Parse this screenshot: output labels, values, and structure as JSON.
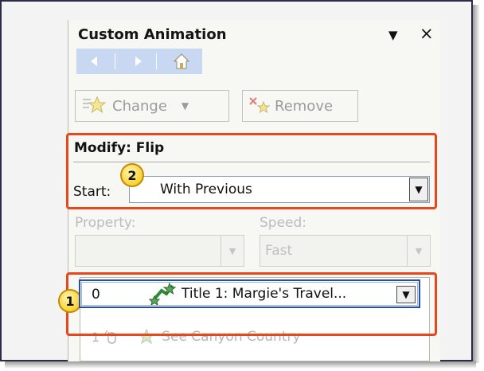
{
  "pane": {
    "title": "Custom Animation",
    "menu_icon": "triangle-down",
    "close_icon": "close-x"
  },
  "nav": {
    "back_icon": "arrow-left",
    "forward_icon": "arrow-right",
    "home_icon": "home"
  },
  "toolbar": {
    "change_label": "Change",
    "remove_label": "Remove"
  },
  "modify": {
    "heading": "Modify: Flip",
    "start_label": "Start:",
    "start_value": "With Previous"
  },
  "property": {
    "label": "Property:",
    "value": ""
  },
  "speed": {
    "label": "Speed:",
    "value": "Fast"
  },
  "animation_list": {
    "items": [
      {
        "index": "0",
        "label": "Title 1: Margie's Travel...",
        "selected": true
      },
      {
        "index": "1",
        "label": "See Canyon Country",
        "selected": false
      }
    ]
  },
  "callouts": [
    "1",
    "2"
  ],
  "colors": {
    "highlight": "#e8461b",
    "badge": "#f5c400",
    "selection": "#1f4fb5",
    "nav_bar": "#c8d7f2"
  }
}
